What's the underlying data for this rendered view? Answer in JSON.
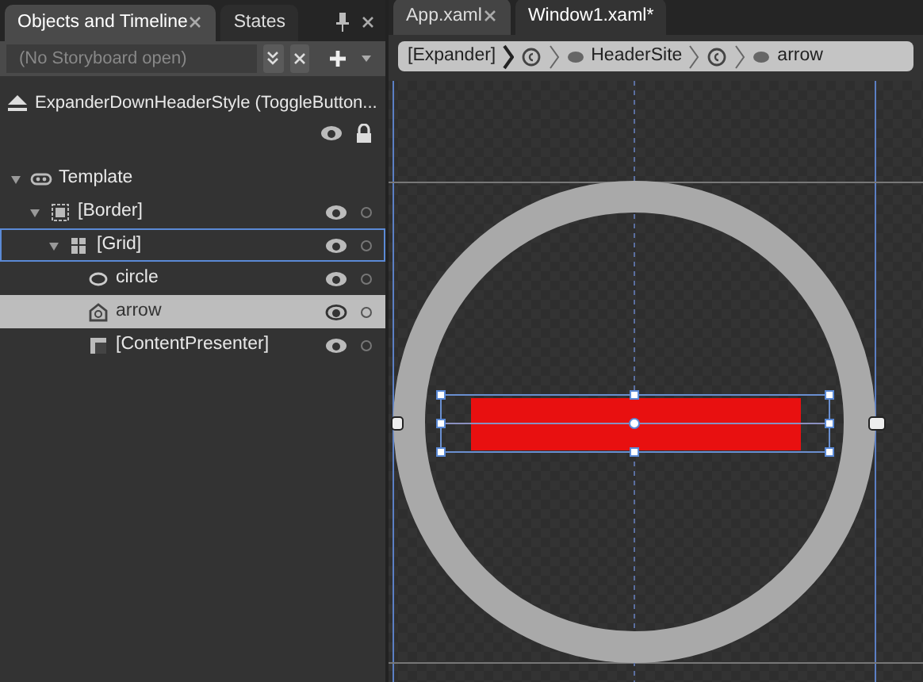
{
  "left_panel": {
    "tabs": [
      {
        "label": "Objects and Timeline",
        "selected": true,
        "closable": true
      },
      {
        "label": "States",
        "selected": false,
        "closable": false
      }
    ],
    "storyboard": {
      "placeholder": "(No Storyboard open)"
    },
    "scope": {
      "label": "ExpanderDownHeaderStyle (ToggleButton..."
    },
    "tree": [
      {
        "label": "Template",
        "kind": "template",
        "expanded": true,
        "selected": false,
        "focused": false,
        "children": [
          {
            "label": "[Border]",
            "kind": "border",
            "expanded": true,
            "selected": false,
            "focused": false,
            "children": [
              {
                "label": "[Grid]",
                "kind": "grid",
                "expanded": true,
                "selected": false,
                "focused": true,
                "children": [
                  {
                    "label": "circle",
                    "kind": "ellipse",
                    "selected": false,
                    "focused": false
                  },
                  {
                    "label": "arrow",
                    "kind": "path",
                    "selected": true,
                    "focused": false
                  },
                  {
                    "label": "[ContentPresenter]",
                    "kind": "presenter",
                    "selected": false,
                    "focused": false
                  }
                ]
              }
            ]
          }
        ]
      }
    ]
  },
  "document_tabs": [
    {
      "label": "App.xaml",
      "selected": false,
      "closable": true
    },
    {
      "label": "Window1.xaml*",
      "selected": true,
      "closable": false
    }
  ],
  "breadcrumb": [
    {
      "label": "[Expander]",
      "kind": "text"
    },
    {
      "kind": "template-icon"
    },
    {
      "label": "HeaderSite",
      "kind": "element"
    },
    {
      "kind": "template-icon"
    },
    {
      "label": "arrow",
      "kind": "element"
    }
  ]
}
